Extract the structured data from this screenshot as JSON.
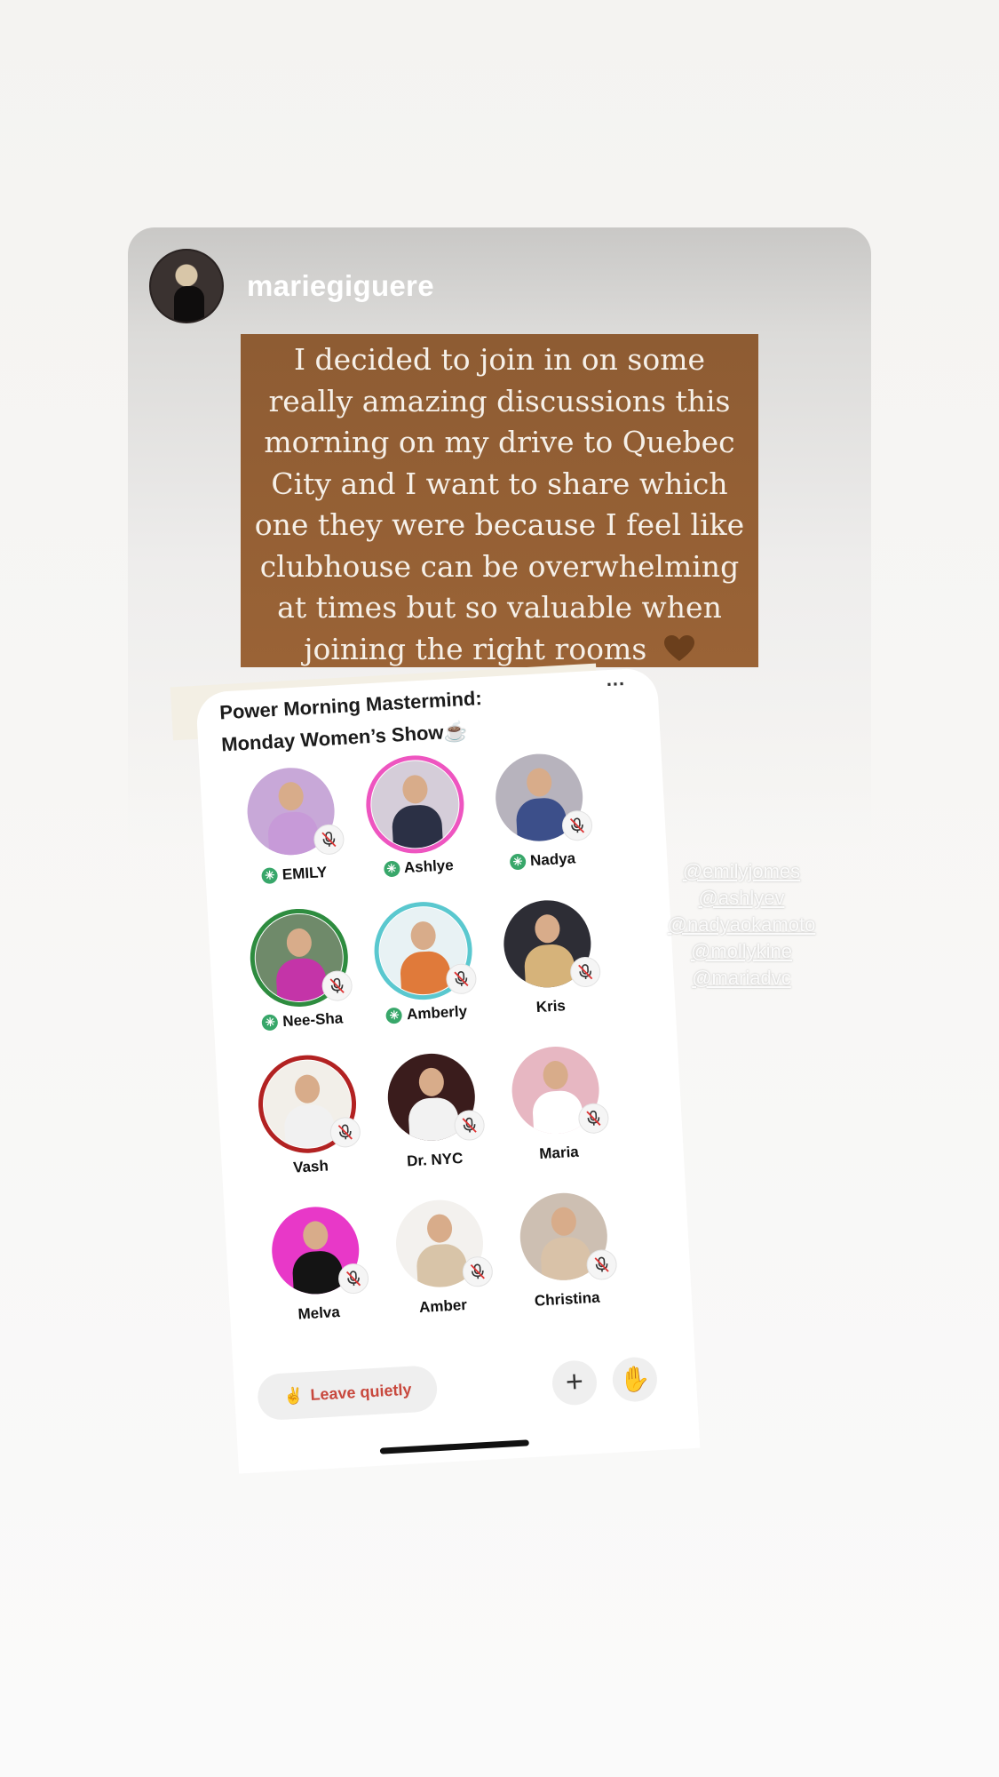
{
  "story": {
    "username": "mariegiguere",
    "caption": "I decided to join in on some really amazing discussions this morning on my drive to Quebec City and I want to share which one they were because I feel like clubhouse can be overwhelming at times but so valuable when joining the right rooms"
  },
  "room": {
    "title_line1": "Power Morning Mastermind:",
    "title_line2": "Monday Women’s Show☕",
    "speakers": [
      {
        "name": "EMILY",
        "moderator": true,
        "muted": true,
        "ring": "none",
        "bg": "#c8a8d8",
        "outfit": "#c79ad8"
      },
      {
        "name": "Ashlye",
        "moderator": true,
        "muted": false,
        "ring": "#ee55c0",
        "bg": "#d5cdd9",
        "outfit": "#2b3045"
      },
      {
        "name": "Nadya",
        "moderator": true,
        "muted": true,
        "ring": "none",
        "bg": "#b7b3bd",
        "outfit": "#3c4f8a"
      },
      {
        "name": "Nee-Sha",
        "moderator": true,
        "muted": true,
        "ring": "#2e8c3f",
        "bg": "#6f8a6a",
        "outfit": "#c434a8"
      },
      {
        "name": "Amberly",
        "moderator": true,
        "muted": true,
        "ring": "#5ac8cf",
        "bg": "#e8f2f4",
        "outfit": "#e07a3a"
      },
      {
        "name": "Kris",
        "moderator": false,
        "muted": true,
        "ring": "none",
        "bg": "#2d2d35",
        "outfit": "#d6b37a"
      },
      {
        "name": "Vash",
        "moderator": false,
        "muted": true,
        "ring": "#b22222",
        "bg": "#f2efe9",
        "outfit": "#f1f1f1"
      },
      {
        "name": "Dr. NYC",
        "moderator": false,
        "muted": true,
        "ring": "none",
        "bg": "#3a1c1c",
        "outfit": "#f2f2f2"
      },
      {
        "name": "Maria",
        "moderator": false,
        "muted": true,
        "ring": "none",
        "bg": "#e7b7c2",
        "outfit": "#ffffff"
      },
      {
        "name": "Melva",
        "moderator": false,
        "muted": true,
        "ring": "none",
        "bg": "#e838c8",
        "outfit": "#141414"
      },
      {
        "name": "Amber",
        "moderator": false,
        "muted": true,
        "ring": "none",
        "bg": "#f3f1ee",
        "outfit": "#d8c4a8"
      },
      {
        "name": "Christina",
        "moderator": false,
        "muted": true,
        "ring": "none",
        "bg": "#cdbfb2",
        "outfit": "#d9c2a8"
      }
    ],
    "leave_label": "Leave quietly",
    "leave_emoji": "✌️",
    "plus_label": "+",
    "hand_emoji": "✋",
    "more_label": "..."
  },
  "mentions": [
    "@emilyjomes",
    "@ashlyev",
    "@nadyaokamoto",
    "@mollykine",
    "@mariadvc"
  ]
}
